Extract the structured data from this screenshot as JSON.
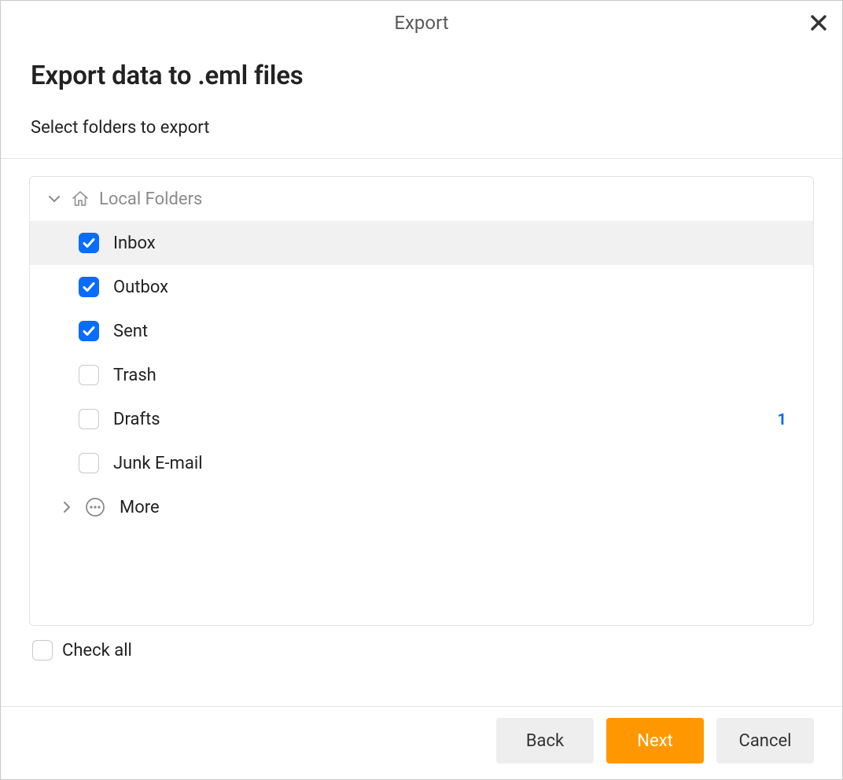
{
  "window": {
    "title": "Export"
  },
  "header": {
    "page_title": "Export data to .eml files",
    "subtitle": "Select folders to export"
  },
  "tree": {
    "root": {
      "label": "Local Folders"
    },
    "items": [
      {
        "label": "Inbox",
        "checked": true,
        "selected": true,
        "badge": ""
      },
      {
        "label": "Outbox",
        "checked": true,
        "selected": false,
        "badge": ""
      },
      {
        "label": "Sent",
        "checked": true,
        "selected": false,
        "badge": ""
      },
      {
        "label": "Trash",
        "checked": false,
        "selected": false,
        "badge": ""
      },
      {
        "label": "Drafts",
        "checked": false,
        "selected": false,
        "badge": "1"
      },
      {
        "label": "Junk E-mail",
        "checked": false,
        "selected": false,
        "badge": ""
      }
    ],
    "more": {
      "label": "More"
    }
  },
  "check_all": {
    "label": "Check all",
    "checked": false
  },
  "buttons": {
    "back": "Back",
    "next": "Next",
    "cancel": "Cancel"
  },
  "colors": {
    "accent_orange": "#ff9800",
    "accent_blue": "#0a6bff"
  }
}
